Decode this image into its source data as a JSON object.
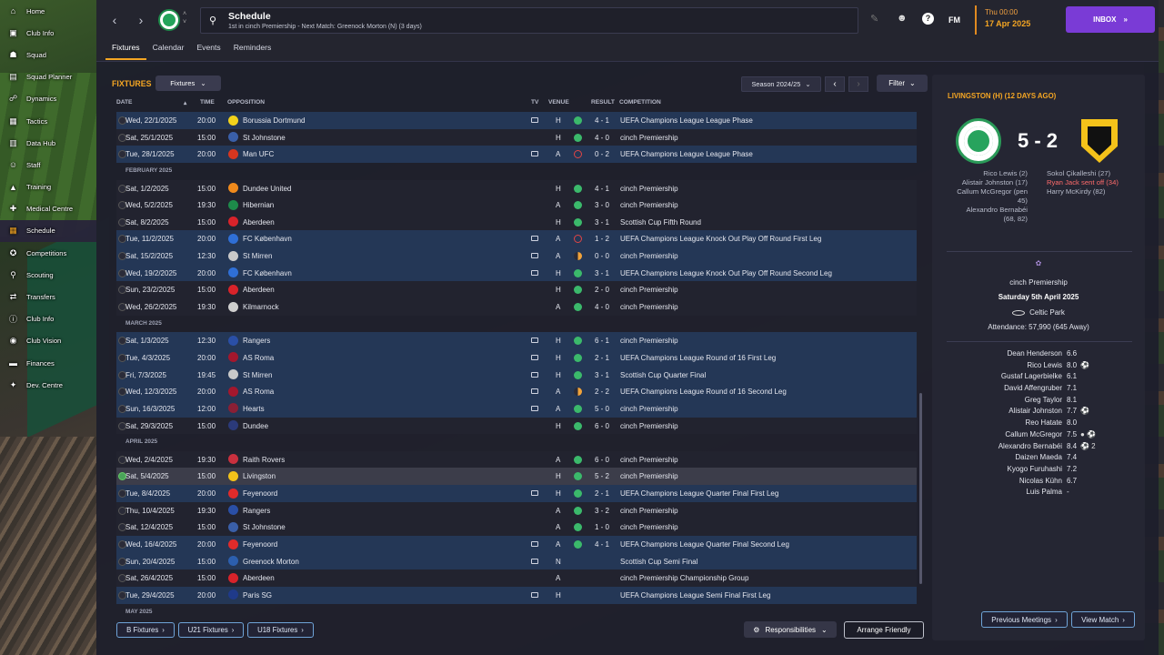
{
  "sidebar": {
    "items": [
      {
        "label": "Home",
        "icon": "home-icon",
        "glyph": "⌂"
      },
      {
        "label": "Club Info",
        "icon": "club-icon",
        "glyph": "▣"
      },
      {
        "label": "Squad",
        "icon": "squad-icon",
        "glyph": "☗"
      },
      {
        "label": "Squad Planner",
        "icon": "planner-icon",
        "glyph": "▤"
      },
      {
        "label": "Dynamics",
        "icon": "dynamics-icon",
        "glyph": "☍"
      },
      {
        "label": "Tactics",
        "icon": "tactics-icon",
        "glyph": "▦"
      },
      {
        "label": "Data Hub",
        "icon": "datahub-icon",
        "glyph": "▥"
      },
      {
        "label": "Staff",
        "icon": "staff-icon",
        "glyph": "☺"
      },
      {
        "label": "Training",
        "icon": "training-icon",
        "glyph": "▲"
      },
      {
        "label": "Medical Centre",
        "icon": "medical-icon",
        "glyph": "✚"
      },
      {
        "label": "Schedule",
        "icon": "schedule-icon",
        "glyph": "▦"
      },
      {
        "label": "Competitions",
        "icon": "competitions-icon",
        "glyph": "✪"
      },
      {
        "label": "Scouting",
        "icon": "scouting-icon",
        "glyph": "⚲"
      },
      {
        "label": "Transfers",
        "icon": "transfers-icon",
        "glyph": "⇄"
      },
      {
        "label": "Club Info",
        "icon": "club-info-icon",
        "glyph": "ⓘ"
      },
      {
        "label": "Club Vision",
        "icon": "vision-icon",
        "glyph": "◉"
      },
      {
        "label": "Finances",
        "icon": "finances-icon",
        "glyph": "▬"
      },
      {
        "label": "Dev. Centre",
        "icon": "dev-centre-icon",
        "glyph": "✦"
      }
    ],
    "active_index": 10
  },
  "header": {
    "title": "Schedule",
    "subtitle": "1st in cinch Premiership - Next Match: Greenock Morton (N) (3 days)",
    "fm_label": "FM",
    "date_line1": "Thu 00:00",
    "date_line2": "17 Apr 2025",
    "inbox_label": "INBOX"
  },
  "tabs": [
    "Fixtures",
    "Calendar",
    "Events",
    "Reminders"
  ],
  "fixtures": {
    "title": "FIXTURES",
    "view_dropdown": "Fixtures",
    "season": "Season 2024/25",
    "filter_label": "Filter",
    "columns": {
      "date": "DATE",
      "time": "TIME",
      "opposition": "OPPOSITION",
      "tv": "TV",
      "venue": "VENUE",
      "result": "RESULT",
      "competition": "COMPETITION"
    },
    "rows": [
      {
        "type": "match",
        "date": "Wed, 22/1/2025",
        "time": "20:00",
        "opp": "Borussia Dortmund",
        "badge": "#f2d21b",
        "tv": true,
        "venue": "H",
        "res": "win",
        "score": "4 - 1",
        "comp": "UEFA Champions League League Phase"
      },
      {
        "type": "match",
        "date": "Sat, 25/1/2025",
        "time": "15:00",
        "opp": "St Johnstone",
        "badge": "#3a5fa8",
        "tv": false,
        "venue": "H",
        "res": "win",
        "score": "4 - 0",
        "comp": "cinch Premiership"
      },
      {
        "type": "match",
        "date": "Tue, 28/1/2025",
        "time": "20:00",
        "opp": "Man UFC",
        "badge": "#d6361f",
        "tv": true,
        "venue": "A",
        "res": "loss",
        "score": "0 - 2",
        "comp": "UEFA Champions League League Phase"
      },
      {
        "type": "month",
        "label": "FEBRUARY 2025"
      },
      {
        "type": "match",
        "date": "Sat, 1/2/2025",
        "time": "15:00",
        "opp": "Dundee United",
        "badge": "#f08a1c",
        "tv": false,
        "venue": "H",
        "res": "win",
        "score": "4 - 1",
        "comp": "cinch Premiership"
      },
      {
        "type": "match",
        "date": "Wed, 5/2/2025",
        "time": "19:30",
        "opp": "Hibernian",
        "badge": "#1d8a4a",
        "tv": false,
        "venue": "A",
        "res": "win",
        "score": "3 - 0",
        "comp": "cinch Premiership"
      },
      {
        "type": "match",
        "date": "Sat, 8/2/2025",
        "time": "15:00",
        "opp": "Aberdeen",
        "badge": "#d8232a",
        "tv": false,
        "venue": "H",
        "res": "win",
        "score": "3 - 1",
        "comp": "Scottish Cup Fifth Round"
      },
      {
        "type": "match",
        "date": "Tue, 11/2/2025",
        "time": "20:00",
        "opp": "FC København",
        "badge": "#2f6fd6",
        "tv": true,
        "venue": "A",
        "res": "loss",
        "score": "1 - 2",
        "comp": "UEFA Champions League Knock Out Play Off Round First Leg"
      },
      {
        "type": "match",
        "date": "Sat, 15/2/2025",
        "time": "12:30",
        "opp": "St Mirren",
        "badge": "#c9c9c9",
        "tv": true,
        "venue": "A",
        "res": "draw",
        "score": "0 - 0",
        "comp": "cinch Premiership"
      },
      {
        "type": "match",
        "date": "Wed, 19/2/2025",
        "time": "20:00",
        "opp": "FC København",
        "badge": "#2f6fd6",
        "tv": true,
        "venue": "H",
        "res": "win",
        "score": "3 - 1",
        "comp": "UEFA Champions League Knock Out Play Off Round Second Leg"
      },
      {
        "type": "match",
        "date": "Sun, 23/2/2025",
        "time": "15:00",
        "opp": "Aberdeen",
        "badge": "#d8232a",
        "tv": false,
        "venue": "H",
        "res": "win",
        "score": "2 - 0",
        "comp": "cinch Premiership"
      },
      {
        "type": "match",
        "date": "Wed, 26/2/2025",
        "time": "19:30",
        "opp": "Kilmarnock",
        "badge": "#cfcfcf",
        "tv": false,
        "venue": "A",
        "res": "win",
        "score": "4 - 0",
        "comp": "cinch Premiership"
      },
      {
        "type": "month",
        "label": "MARCH 2025"
      },
      {
        "type": "match",
        "date": "Sat, 1/3/2025",
        "time": "12:30",
        "opp": "Rangers",
        "badge": "#2a4fa6",
        "tv": true,
        "venue": "H",
        "res": "win",
        "score": "6 - 1",
        "comp": "cinch Premiership"
      },
      {
        "type": "match",
        "date": "Tue, 4/3/2025",
        "time": "20:00",
        "opp": "AS Roma",
        "badge": "#a3172d",
        "tv": true,
        "venue": "H",
        "res": "win",
        "score": "2 - 1",
        "comp": "UEFA Champions League Round of 16  First Leg"
      },
      {
        "type": "match",
        "date": "Fri, 7/3/2025",
        "time": "19:45",
        "opp": "St Mirren",
        "badge": "#c9c9c9",
        "tv": true,
        "venue": "H",
        "res": "win",
        "score": "3 - 1",
        "comp": "Scottish Cup Quarter Final"
      },
      {
        "type": "match",
        "date": "Wed, 12/3/2025",
        "time": "20:00",
        "opp": "AS Roma",
        "badge": "#a3172d",
        "tv": true,
        "venue": "A",
        "res": "draw",
        "score": "2 - 2",
        "comp": "UEFA Champions League Round of 16  Second Leg"
      },
      {
        "type": "match",
        "date": "Sun, 16/3/2025",
        "time": "12:00",
        "opp": "Hearts",
        "badge": "#8a1f35",
        "tv": true,
        "venue": "A",
        "res": "win",
        "score": "5 - 0",
        "comp": "cinch Premiership"
      },
      {
        "type": "match",
        "date": "Sat, 29/3/2025",
        "time": "15:00",
        "opp": "Dundee",
        "badge": "#2b3a7a",
        "tv": false,
        "venue": "H",
        "res": "win",
        "score": "6 - 0",
        "comp": "cinch Premiership"
      },
      {
        "type": "month",
        "label": "APRIL 2025"
      },
      {
        "type": "match",
        "date": "Wed, 2/4/2025",
        "time": "19:30",
        "opp": "Raith Rovers",
        "badge": "#c9303e",
        "tv": false,
        "venue": "A",
        "res": "win",
        "score": "6 - 0",
        "comp": "cinch Premiership"
      },
      {
        "type": "match",
        "date": "Sat, 5/4/2025",
        "time": "15:00",
        "opp": "Livingston",
        "badge": "#f2c21a",
        "tv": false,
        "venue": "H",
        "res": "win",
        "score": "5 - 2",
        "comp": "cinch Premiership",
        "selected": true
      },
      {
        "type": "match",
        "date": "Tue, 8/4/2025",
        "time": "20:00",
        "opp": "Feyenoord",
        "badge": "#e02b2b",
        "tv": true,
        "venue": "H",
        "res": "win",
        "score": "2 - 1",
        "comp": "UEFA Champions League Quarter Final First Leg"
      },
      {
        "type": "match",
        "date": "Thu, 10/4/2025",
        "time": "19:30",
        "opp": "Rangers",
        "badge": "#2a4fa6",
        "tv": false,
        "venue": "A",
        "res": "win",
        "score": "3 - 2",
        "comp": "cinch Premiership"
      },
      {
        "type": "match",
        "date": "Sat, 12/4/2025",
        "time": "15:00",
        "opp": "St Johnstone",
        "badge": "#3a5fa8",
        "tv": false,
        "venue": "A",
        "res": "win",
        "score": "1 - 0",
        "comp": "cinch Premiership"
      },
      {
        "type": "match",
        "date": "Wed, 16/4/2025",
        "time": "20:00",
        "opp": "Feyenoord",
        "badge": "#e02b2b",
        "tv": true,
        "venue": "A",
        "res": "win",
        "score": "4 - 1",
        "comp": "UEFA Champions League Quarter Final Second Leg"
      },
      {
        "type": "match",
        "date": "Sun, 20/4/2025",
        "time": "15:00",
        "opp": "Greenock Morton",
        "badge": "#2c5fae",
        "tv": true,
        "venue": "N",
        "res": "",
        "score": "",
        "comp": "Scottish Cup Semi Final"
      },
      {
        "type": "match",
        "date": "Sat, 26/4/2025",
        "time": "15:00",
        "opp": "Aberdeen",
        "badge": "#d8232a",
        "tv": false,
        "venue": "A",
        "res": "",
        "score": "",
        "comp": "cinch Premiership Championship Group"
      },
      {
        "type": "match",
        "date": "Tue, 29/4/2025",
        "time": "20:00",
        "opp": "Paris SG",
        "badge": "#1f3a8a",
        "tv": true,
        "venue": "H",
        "res": "",
        "score": "",
        "comp": "UEFA Champions League Semi Final First Leg"
      },
      {
        "type": "month",
        "label": "MAY 2025"
      }
    ],
    "bottom": {
      "b_fixtures": "B Fixtures",
      "u21_fixtures": "U21 Fixtures",
      "u18_fixtures": "U18 Fixtures",
      "responsibilities": "Responsibilities",
      "arrange": "Arrange Friendly"
    }
  },
  "match_panel": {
    "title": "LIVINGSTON (H) (12 DAYS AGO)",
    "score": "5 - 2",
    "home_scorers": [
      "Rico Lewis (2)",
      "Alistair Johnston (17)",
      "Callum McGregor (pen",
      "45)",
      "Alexandro Bernabéi",
      "(68, 82)"
    ],
    "away_scorers": [
      "Sokol Çikalleshi (27)",
      "Ryan Jack sent off (34)",
      "Harry McKirdy (82)"
    ],
    "competition": "cinch Premiership",
    "date": "Saturday 5th April 2025",
    "venue": "Celtic Park",
    "attendance": "Attendance: 57,990 (645 Away)",
    "players": [
      {
        "name": "Dean Henderson",
        "rating": "6.6",
        "extra": ""
      },
      {
        "name": "Rico Lewis",
        "rating": "8.0",
        "extra": "⚽"
      },
      {
        "name": "Gustaf Lagerbielke",
        "rating": "6.1",
        "extra": ""
      },
      {
        "name": "David Affengruber",
        "rating": "7.1",
        "extra": ""
      },
      {
        "name": "Greg Taylor",
        "rating": "8.1",
        "extra": ""
      },
      {
        "name": "Alistair Johnston",
        "rating": "7.7",
        "extra": "⚽"
      },
      {
        "name": "Reo Hatate",
        "rating": "8.0",
        "extra": ""
      },
      {
        "name": "Callum McGregor",
        "rating": "7.5",
        "extra": "● ⚽"
      },
      {
        "name": "Alexandro Bernabéi",
        "rating": "8.4",
        "extra": "⚽ 2"
      },
      {
        "name": "Daizen Maeda",
        "rating": "7.4",
        "extra": ""
      },
      {
        "name": "Kyogo Furuhashi",
        "rating": "7.2",
        "extra": ""
      },
      {
        "name": "Nicolas Kühn",
        "rating": "6.7",
        "extra": ""
      },
      {
        "name": "Luis Palma",
        "rating": "-",
        "extra": ""
      }
    ],
    "prev_meetings": "Previous Meetings",
    "view_match": "View Match"
  }
}
